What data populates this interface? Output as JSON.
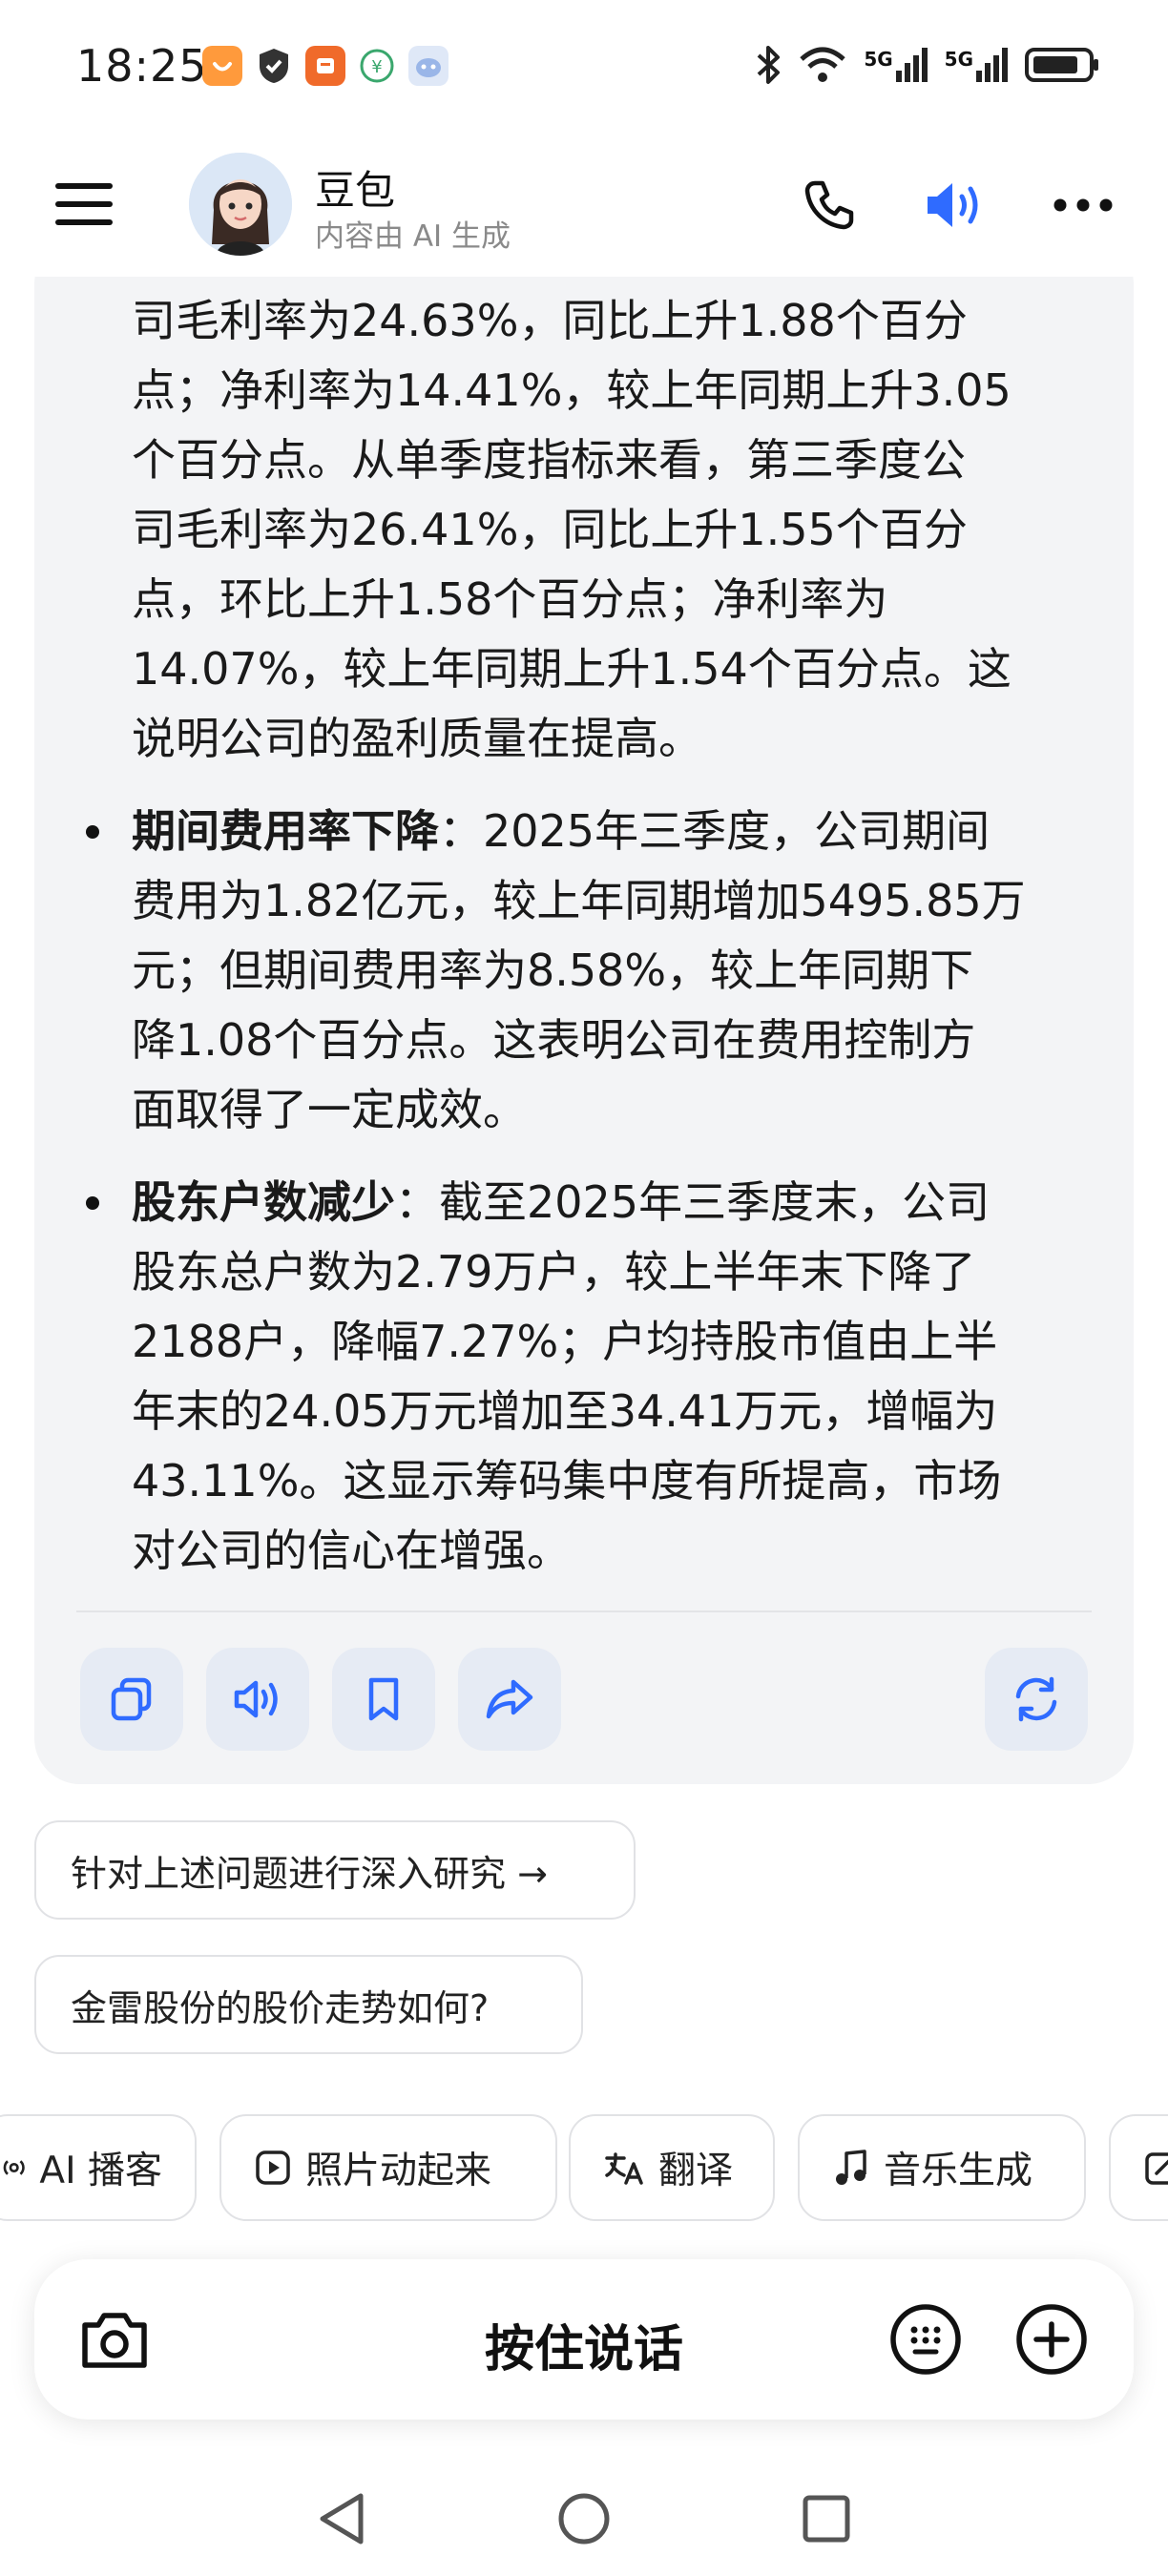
{
  "status_bar": {
    "time": "18:25",
    "net_label_1": "5G",
    "net_label_2": "5G"
  },
  "header": {
    "bot_name": "豆包",
    "bot_subtitle": "内容由 AI 生成"
  },
  "message": {
    "intro_lines": [
      "司毛利率为24.63%，同比上升1.88个百分",
      "点；净利率为14.41%，较上年同期上升3.05",
      "个百分点。从单季度指标来看，第三季度公",
      "司毛利率为26.41%，同比上升1.55个百分",
      "点，环比上升1.58个百分点；净利率为",
      "14.07%，较上年同期上升1.54个百分点。这",
      "说明公司的盈利质量在提高。"
    ],
    "bullets": [
      {
        "title": "期间费用率下降",
        "lines": [
          "：2025年三季度，公司期间",
          "费用为1.82亿元，较上年同期增加5495.85万",
          "元；但期间费用率为8.58%，较上年同期下",
          "降1.08个百分点。这表明公司在费用控制方",
          "面取得了一定成效。"
        ]
      },
      {
        "title": "股东户数减少",
        "lines": [
          "：截至2025年三季度末，公司",
          "股东总户数为2.79万户，较上半年末下降了",
          "2188户，降幅7.27%；户均持股市值由上半",
          "年末的24.05万元增加至34.41万元，增幅为",
          "43.11%。这显示筹码集中度有所提高，市场",
          "对公司的信心在增强。"
        ]
      }
    ]
  },
  "suggestions": [
    "针对上述问题进行深入研究 →",
    "金雷股份的股价走势如何?"
  ],
  "tools": [
    {
      "label": "AI 播客",
      "icon": "podcast-icon"
    },
    {
      "label": "照片动起来",
      "icon": "play-icon"
    },
    {
      "label": "翻译",
      "icon": "translate-icon"
    },
    {
      "label": "音乐生成",
      "icon": "music-icon"
    },
    {
      "label": "",
      "icon": "edit-icon"
    }
  ],
  "input_bar": {
    "hold_to_talk": "按住说话"
  },
  "colors": {
    "accent": "#2f6bff",
    "bubble_bg": "#f3f4f6",
    "action_btn_bg": "#e6ebf4"
  }
}
